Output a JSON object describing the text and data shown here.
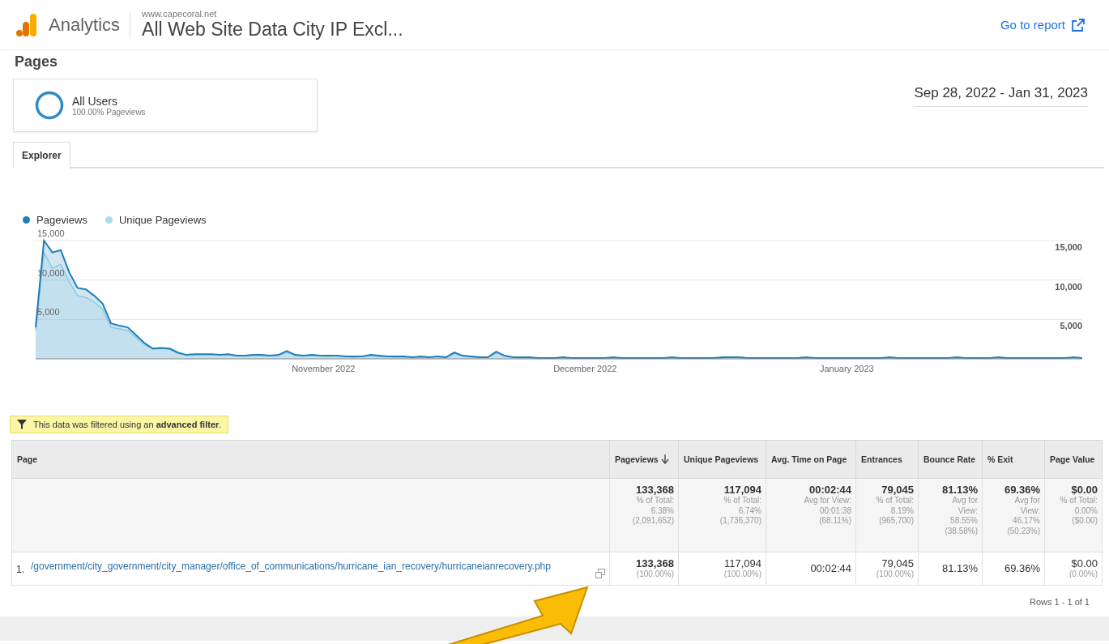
{
  "header": {
    "product": "Analytics",
    "property": "www.capecoral.net",
    "view": "All Web Site Data City IP Excl...",
    "go_to_report": "Go to report"
  },
  "report": {
    "title": "Pages",
    "segment": {
      "name": "All Users",
      "detail": "100.00% Pageviews"
    },
    "date_range": "Sep 28, 2022 - Jan 31, 2023"
  },
  "tabs": [
    {
      "label": "Explorer",
      "selected": true
    }
  ],
  "chart": {
    "month_labels": [
      "November 2022",
      "December 2022",
      "January 2023"
    ],
    "chart_data": {
      "type": "area",
      "grid": true,
      "ylim": [
        0,
        15000
      ],
      "yticks": [
        {
          "value": 5000,
          "label": "5,000"
        },
        {
          "value": 10000,
          "label": "10,000"
        },
        {
          "value": 15000,
          "label": "15,000"
        }
      ],
      "series": [
        {
          "name": "Pageviews",
          "color": "#1f7fb8",
          "values": [
            4000,
            15000,
            13500,
            13800,
            11000,
            9000,
            8800,
            8000,
            7000,
            4500,
            4200,
            4000,
            3000,
            2000,
            1300,
            1400,
            1300,
            800,
            500,
            600,
            600,
            600,
            500,
            600,
            400,
            400,
            500,
            500,
            400,
            500,
            1000,
            500,
            400,
            500,
            400,
            400,
            400,
            300,
            300,
            300,
            500,
            400,
            300,
            300,
            300,
            200,
            300,
            200,
            300,
            200,
            800,
            400,
            300,
            200,
            200,
            900,
            400,
            200,
            200,
            200,
            100,
            100,
            100,
            200,
            100,
            100,
            100,
            100,
            100,
            200,
            100,
            100,
            100,
            100,
            100,
            100,
            200,
            100,
            100,
            100,
            100,
            100,
            200,
            200,
            200,
            100,
            100,
            100,
            100,
            100,
            100,
            100,
            200,
            100,
            100,
            100,
            100,
            100,
            100,
            100,
            100,
            100,
            200,
            100,
            100,
            100,
            100,
            100,
            100,
            100,
            200,
            100,
            100,
            100,
            100,
            200,
            100,
            100,
            100,
            100,
            100,
            100,
            100,
            100,
            200,
            100
          ]
        },
        {
          "name": "Unique Pageviews",
          "color": "#a9dcef",
          "values": [
            3500,
            13500,
            11500,
            12000,
            9800,
            8000,
            7800,
            7200,
            6300,
            4000,
            3800,
            3600,
            2700,
            1800,
            1200,
            1300,
            1200,
            700,
            500,
            500,
            500,
            500,
            500,
            500,
            400,
            400,
            400,
            400,
            400,
            400,
            800,
            400,
            400,
            400,
            400,
            300,
            400,
            300,
            200,
            300,
            400,
            300,
            300,
            200,
            200,
            200,
            200,
            200,
            300,
            200,
            700,
            400,
            200,
            200,
            200,
            700,
            400,
            200,
            100,
            100,
            100,
            100,
            100,
            100,
            100,
            100,
            100,
            100,
            100,
            100,
            100,
            100,
            100,
            100,
            100,
            100,
            100,
            100,
            100,
            100,
            100,
            100,
            100,
            200,
            200,
            100,
            100,
            100,
            100,
            100,
            100,
            100,
            100,
            100,
            100,
            100,
            100,
            100,
            100,
            100,
            100,
            100,
            100,
            100,
            100,
            100,
            100,
            100,
            100,
            100,
            100,
            100,
            100,
            100,
            100,
            100,
            100,
            100,
            100,
            100,
            100,
            100,
            100,
            100,
            100,
            100
          ]
        }
      ]
    }
  },
  "filter_notice": "This data was filtered using an **advanced filter**.",
  "table": {
    "columns": [
      {
        "label": "Page",
        "sorted": false
      },
      {
        "label": "Pageviews",
        "sorted": true
      },
      {
        "label": "Unique Pageviews",
        "sorted": false
      },
      {
        "label": "Avg. Time on Page",
        "sorted": false
      },
      {
        "label": "Entrances",
        "sorted": false
      },
      {
        "label": "Bounce Rate",
        "sorted": false
      },
      {
        "label": "% Exit",
        "sorted": false
      },
      {
        "label": "Page Value",
        "sorted": false
      }
    ],
    "totals": [
      {
        "value": "133,368",
        "detail": [
          "% of Total:",
          "6.38%",
          "(2,091,652)"
        ]
      },
      {
        "value": "117,094",
        "detail": [
          "% of Total:",
          "6.74%",
          "(1,736,370)"
        ]
      },
      {
        "value": "00:02:44",
        "detail": [
          "Avg for View:",
          "00:01:38",
          "(68.11%)"
        ]
      },
      {
        "value": "79,045",
        "detail": [
          "% of Total:",
          "8.19%",
          "(965,700)"
        ]
      },
      {
        "value": "81.13%",
        "detail": [
          "Avg for",
          "View:",
          "58.55%",
          "(38.58%)"
        ]
      },
      {
        "value": "69.36%",
        "detail": [
          "Avg for",
          "View:",
          "46.17%",
          "(50.23%)"
        ]
      },
      {
        "value": "$0.00",
        "detail": [
          "% of Total:",
          "0.00%",
          "($0.00)"
        ]
      }
    ],
    "rows": [
      {
        "cells": [
          {
            "index": "1.",
            "value": "/government/city_government/city_manager/office_of_communications/hurricane_ian_recovery/hurricaneianrecovery.php"
          },
          {
            "value": "133,368",
            "detail": "(100.00%)"
          },
          {
            "value": "117,094",
            "detail": "(100.00%)"
          },
          {
            "value": "00:02:44"
          },
          {
            "value": "79,045",
            "detail": "(100.00%)"
          },
          {
            "value": "81.13%"
          },
          {
            "value": "69.36%"
          },
          {
            "value": "$0.00",
            "detail": "(0.00%)"
          }
        ]
      }
    ],
    "pagination": "Rows 1 - 1 of 1"
  }
}
